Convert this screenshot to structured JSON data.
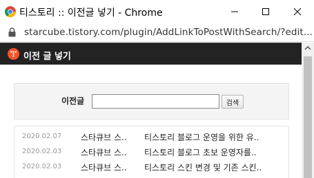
{
  "window": {
    "title": "티스토리 :: 이전글 넣기 - Chrome",
    "controls": [
      "minimize-icon",
      "maximize-icon",
      "close-icon"
    ]
  },
  "address": {
    "url": "starcube.tistory.com/plugin/AddLinkToPostWithSearch/?edit..."
  },
  "header": {
    "logo": "tistory-logo",
    "title": "이전 글 넣기"
  },
  "search": {
    "label": "이전글",
    "input_value": "",
    "button_label": "검색"
  },
  "posts": [
    {
      "date": "2020.02.07",
      "blog": "스타큐브 스..",
      "title": "티스토리 블로그 운영을 위한 유.."
    },
    {
      "date": "2020.02.03",
      "blog": "스타큐브 스..",
      "title": "티스토리 블로그 초보 운영자를.."
    },
    {
      "date": "2020.02.03",
      "blog": "스타큐브 스..",
      "title": "티스토리 스킨 변경 및 기존 스킨.."
    }
  ],
  "colors": {
    "header_bg": "#232323",
    "tistory_accent": "#f4522a",
    "search_bg": "#f4f4f4"
  }
}
